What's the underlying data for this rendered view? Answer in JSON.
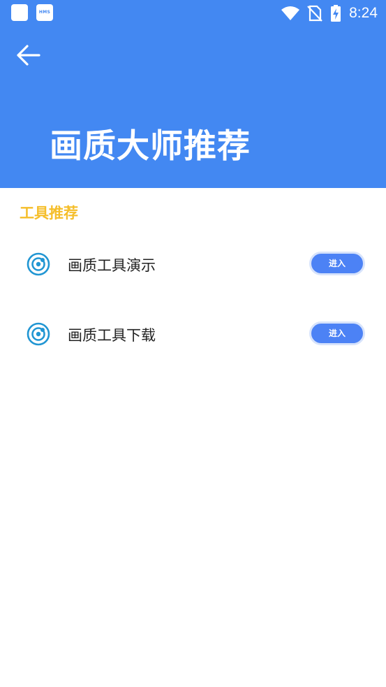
{
  "status_bar": {
    "time": "8:24",
    "notification_icons": [
      "app-icon",
      "hms-icon"
    ],
    "hms_text": "HMS",
    "system_icons": [
      "wifi-icon",
      "no-sim-icon",
      "battery-charging-icon"
    ]
  },
  "header": {
    "back_icon": "arrow-left-icon",
    "title": "画质大师推荐",
    "background_color": "#4388F2"
  },
  "section": {
    "title": "工具推荐",
    "title_color": "#F5BE2A"
  },
  "tools": [
    {
      "label": "画质工具演示",
      "button_label": "进入",
      "icon": "target-icon"
    },
    {
      "label": "画质工具下载",
      "button_label": "进入",
      "icon": "target-icon"
    }
  ],
  "colors": {
    "button": "#4C82F5",
    "icon": "#2196D3"
  }
}
